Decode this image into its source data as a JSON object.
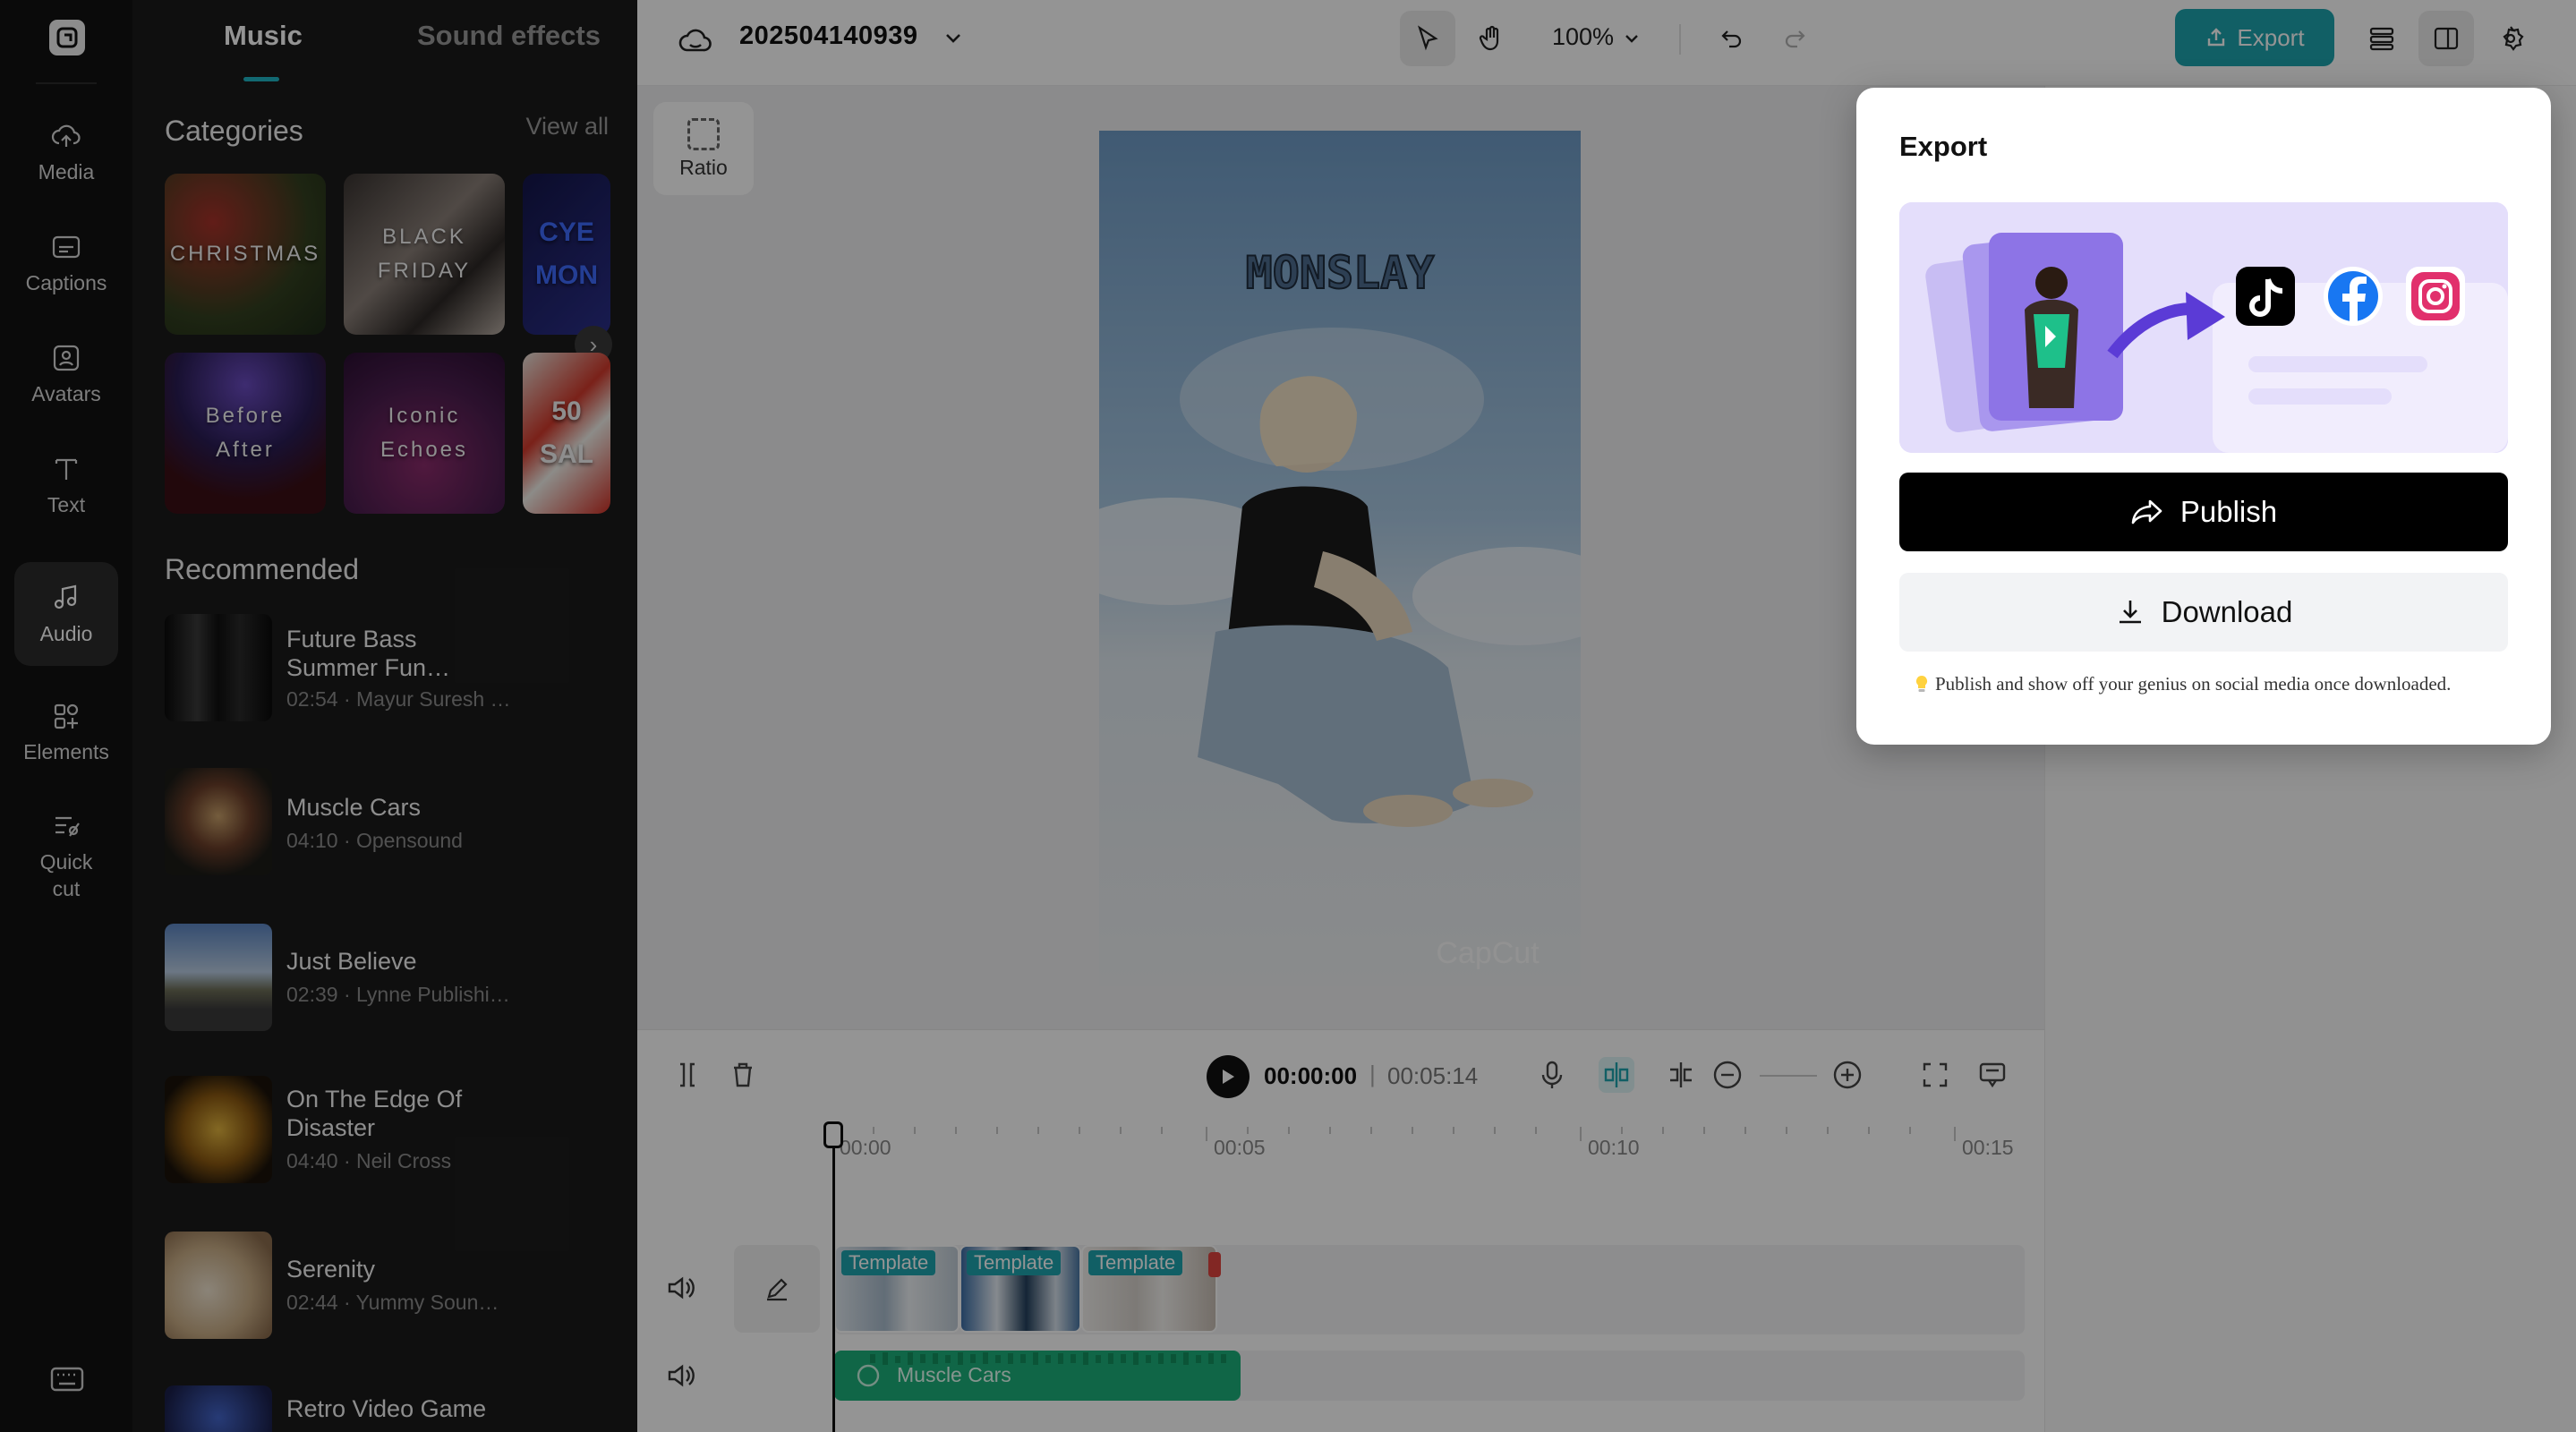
{
  "rail": {
    "items": [
      {
        "label": "Media",
        "icon": "cloud-upload-icon"
      },
      {
        "label": "Captions",
        "icon": "captions-icon"
      },
      {
        "label": "Avatars",
        "icon": "avatar-icon"
      },
      {
        "label": "Text",
        "icon": "text-icon"
      },
      {
        "label": "Audio",
        "icon": "music-note-icon"
      },
      {
        "label": "Elements",
        "icon": "elements-icon"
      },
      {
        "label": "Quick\ncut",
        "icon": "quick-cut-icon"
      }
    ]
  },
  "library": {
    "tabs": [
      "Music",
      "Sound effects"
    ],
    "categories_title": "Categories",
    "view_all": "View all",
    "categories": [
      {
        "label": "CHRISTMAS"
      },
      {
        "label": "BLACK\nFRIDAY"
      },
      {
        "label": "CYE\nMON"
      },
      {
        "label": "Before\nAfter"
      },
      {
        "label": "Iconic\nEchoes"
      },
      {
        "label": "50\nSAL"
      }
    ],
    "recommended_title": "Recommended",
    "tracks": [
      {
        "name": "Future Bass\nSummer Fun…",
        "meta": "02:54 · Mayur Suresh …"
      },
      {
        "name": "Muscle Cars",
        "meta": "04:10 · Opensound"
      },
      {
        "name": "Just Believe",
        "meta": "02:39 · Lynne Publishi…"
      },
      {
        "name": "On The Edge Of\nDisaster",
        "meta": "04:40 · Neil Cross"
      },
      {
        "name": "Serenity",
        "meta": "02:44 · Yummy Soun…"
      },
      {
        "name": "Retro Video Game",
        "meta": ""
      }
    ]
  },
  "topbar": {
    "project_name": "202504140939",
    "zoom": "100%",
    "export_label": "Export"
  },
  "stage": {
    "ratio_label": "Ratio",
    "preview_title": "MONSLAY",
    "watermark": "CapCut"
  },
  "timeline": {
    "current_time": "00:00:00",
    "separator": "|",
    "total_time": "00:05:14",
    "ticks": [
      "00:00",
      "00:05",
      "00:10",
      "00:15"
    ],
    "clips": [
      "Template",
      "Template",
      "Template"
    ],
    "audio_clip": "Muscle Cars"
  },
  "export_popup": {
    "title": "Export",
    "publish_label": "Publish",
    "download_label": "Download",
    "tip": "Publish and show off your genius on social media once downloaded.",
    "social_icons": [
      "tiktok-icon",
      "facebook-icon",
      "instagram-icon"
    ]
  },
  "colors": {
    "accent": "#1ea4ae",
    "audio_clip": "#1db07a",
    "publish_bg": "#000000"
  }
}
